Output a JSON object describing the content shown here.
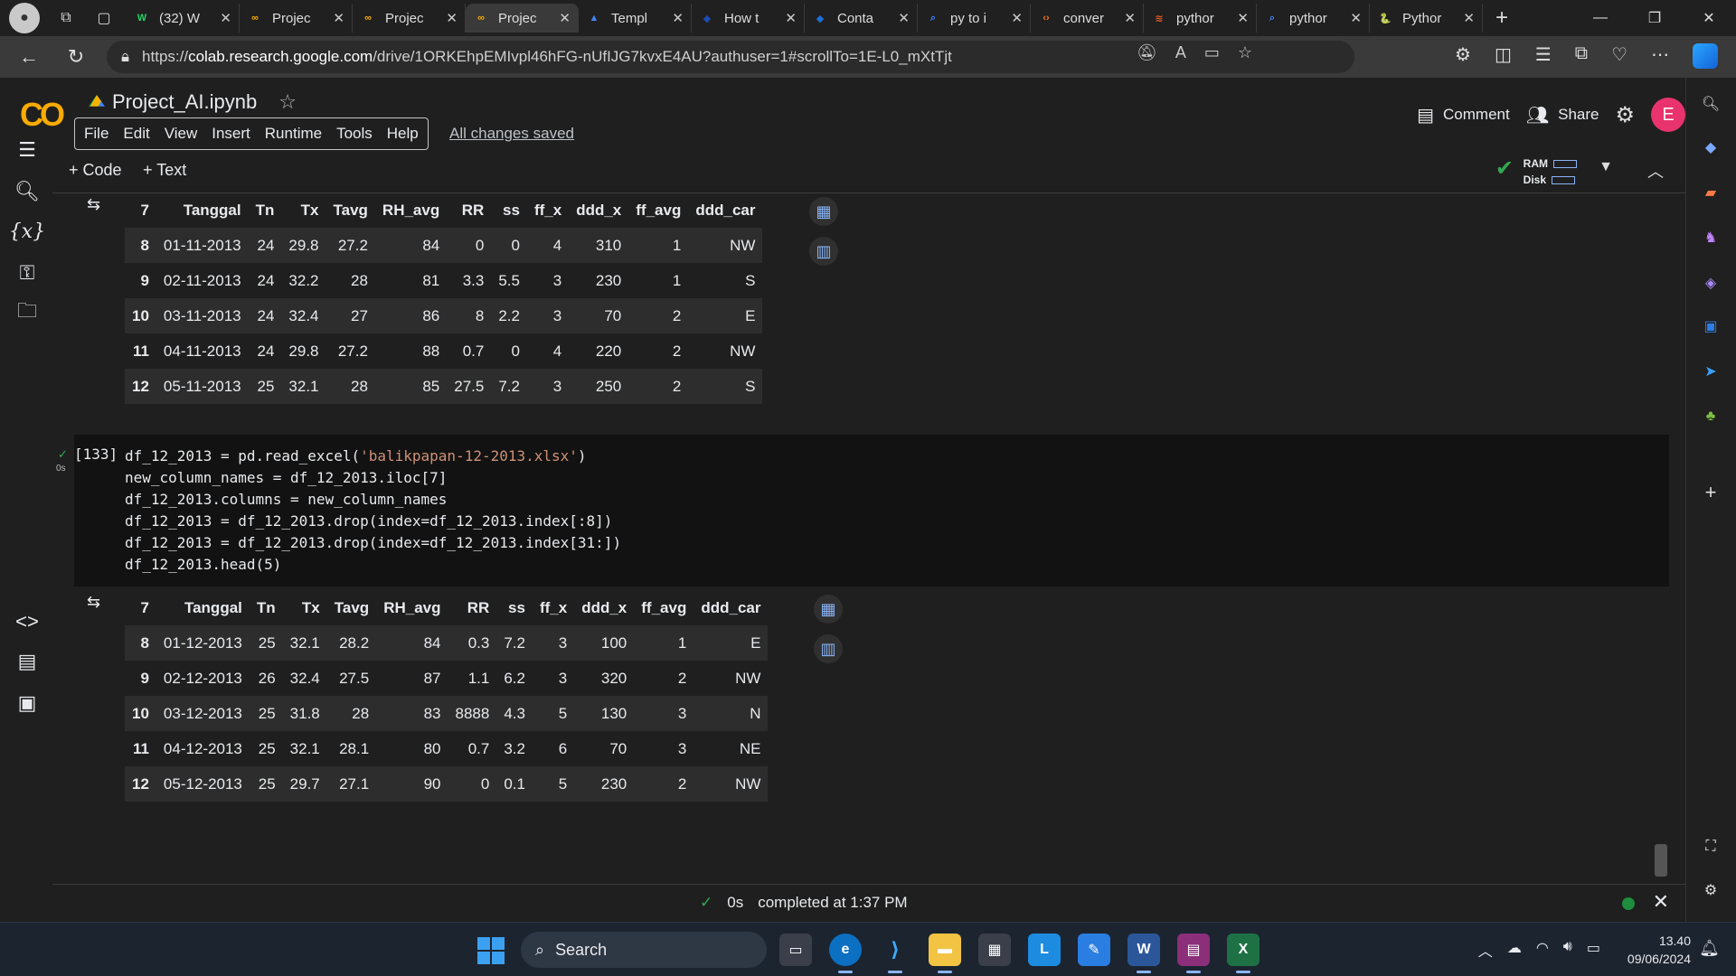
{
  "browser": {
    "tabs": [
      {
        "label": "(32) W",
        "fav_color": "#25d366",
        "fav_glyph": "W"
      },
      {
        "label": "Projec",
        "fav_color": "#f9ab00",
        "fav_glyph": "∞"
      },
      {
        "label": "Projec",
        "fav_color": "#f9ab00",
        "fav_glyph": "∞"
      },
      {
        "label": "Projec",
        "fav_color": "#f9ab00",
        "fav_glyph": "∞"
      },
      {
        "label": "Templ",
        "fav_color": "#4285f4",
        "fav_glyph": "▲"
      },
      {
        "label": "How t",
        "fav_color": "#1b4db3",
        "fav_glyph": "◆"
      },
      {
        "label": "Conta",
        "fav_color": "#1b6fd8",
        "fav_glyph": "◆"
      },
      {
        "label": "py to i",
        "fav_color": "#3b82f6",
        "fav_glyph": "⌕"
      },
      {
        "label": "conver",
        "fav_color": "#f97316",
        "fav_glyph": "‹›"
      },
      {
        "label": "pythor",
        "fav_color": "#e55c2a",
        "fav_glyph": "≋"
      },
      {
        "label": "pythor",
        "fav_color": "#3b82f6",
        "fav_glyph": "⌕"
      },
      {
        "label": "Pythor",
        "fav_color": "#3776ab",
        "fav_glyph": "🐍"
      }
    ],
    "active_tab_index": 3,
    "url_prefix": "https://",
    "url_host": "colab.research.google.com",
    "url_path": "/drive/1ORKEhpEMIvpl46hFG-nUfIJG7kvxE4AU?authuser=1#scrollTo=1E-L0_mXtTjt"
  },
  "colab": {
    "logo": "CO",
    "title": "Project_AI.ipynb",
    "menu": [
      "File",
      "Edit",
      "View",
      "Insert",
      "Runtime",
      "Tools",
      "Help"
    ],
    "saved_status": "All changes saved",
    "comment_label": "Comment",
    "share_label": "Share",
    "avatar_letter": "E",
    "add_code": "+ Code",
    "add_text": "+ Text",
    "ram_label": "RAM",
    "disk_label": "Disk"
  },
  "output1": {
    "columns": [
      "7",
      "Tanggal",
      "Tn",
      "Tx",
      "Tavg",
      "RH_avg",
      "RR",
      "ss",
      "ff_x",
      "ddd_x",
      "ff_avg",
      "ddd_car"
    ],
    "rows": [
      [
        "8",
        "01-11-2013",
        "24",
        "29.8",
        "27.2",
        "84",
        "0",
        "0",
        "4",
        "310",
        "1",
        "NW"
      ],
      [
        "9",
        "02-11-2013",
        "24",
        "32.2",
        "28",
        "81",
        "3.3",
        "5.5",
        "3",
        "230",
        "1",
        "S"
      ],
      [
        "10",
        "03-11-2013",
        "24",
        "32.4",
        "27",
        "86",
        "8",
        "2.2",
        "3",
        "70",
        "2",
        "E"
      ],
      [
        "11",
        "04-11-2013",
        "24",
        "29.8",
        "27.2",
        "88",
        "0.7",
        "0",
        "4",
        "220",
        "2",
        "NW"
      ],
      [
        "12",
        "05-11-2013",
        "25",
        "32.1",
        "28",
        "85",
        "27.5",
        "7.2",
        "3",
        "250",
        "2",
        "S"
      ]
    ]
  },
  "cell": {
    "number": "[133]",
    "exec_time": "0s",
    "lines": [
      "df_12_2013 = pd.read_excel('balikpapan-12-2013.xlsx')",
      "new_column_names = df_12_2013.iloc[7]",
      "df_12_2013.columns = new_column_names",
      "df_12_2013 = df_12_2013.drop(index=df_12_2013.index[:8])",
      "df_12_2013 = df_12_2013.drop(index=df_12_2013.index[31:])",
      "df_12_2013.head(5)"
    ]
  },
  "output2": {
    "columns": [
      "7",
      "Tanggal",
      "Tn",
      "Tx",
      "Tavg",
      "RH_avg",
      "RR",
      "ss",
      "ff_x",
      "ddd_x",
      "ff_avg",
      "ddd_car"
    ],
    "rows": [
      [
        "8",
        "01-12-2013",
        "25",
        "32.1",
        "28.2",
        "84",
        "0.3",
        "7.2",
        "3",
        "100",
        "1",
        "E"
      ],
      [
        "9",
        "02-12-2013",
        "26",
        "32.4",
        "27.5",
        "87",
        "1.1",
        "6.2",
        "3",
        "320",
        "2",
        "NW"
      ],
      [
        "10",
        "03-12-2013",
        "25",
        "31.8",
        "28",
        "83",
        "8888",
        "4.3",
        "5",
        "130",
        "3",
        "N"
      ],
      [
        "11",
        "04-12-2013",
        "25",
        "32.1",
        "28.1",
        "80",
        "0.7",
        "3.2",
        "6",
        "70",
        "3",
        "NE"
      ],
      [
        "12",
        "05-12-2013",
        "25",
        "29.7",
        "27.1",
        "90",
        "0",
        "0.1",
        "5",
        "230",
        "2",
        "NW"
      ]
    ]
  },
  "status": {
    "duration": "0s",
    "message": "completed at 1:37 PM"
  },
  "taskbar": {
    "search_label": "Search",
    "time": "13.40",
    "date": "09/06/2024"
  }
}
